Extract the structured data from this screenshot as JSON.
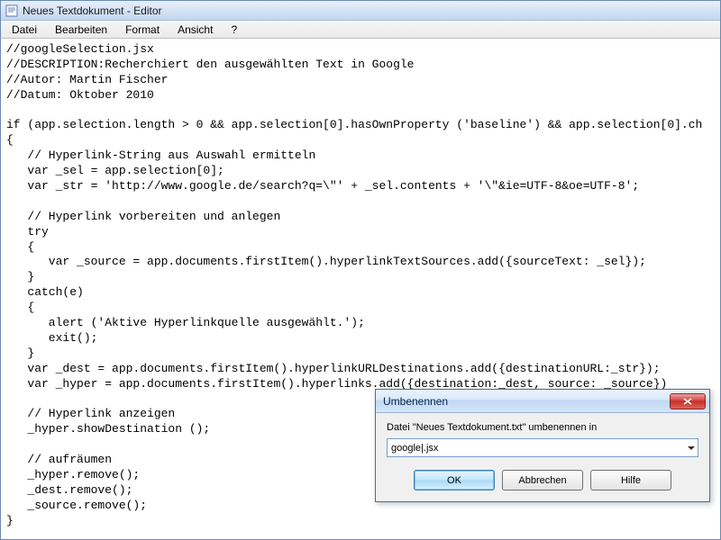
{
  "window": {
    "title": "Neues Textdokument - Editor"
  },
  "menu": {
    "file": "Datei",
    "edit": "Bearbeiten",
    "format": "Format",
    "view": "Ansicht",
    "help": "?"
  },
  "editor": {
    "content": "//googleSelection.jsx\n//DESCRIPTION:Recherchiert den ausgewählten Text in Google\n//Autor: Martin Fischer\n//Datum: Oktober 2010\n\nif (app.selection.length > 0 && app.selection[0].hasOwnProperty ('baseline') && app.selection[0].ch\n{\n   // Hyperlink-String aus Auswahl ermitteln\n   var _sel = app.selection[0];\n   var _str = 'http://www.google.de/search?q=\\\"' + _sel.contents + '\\\"&ie=UTF-8&oe=UTF-8';\n\n   // Hyperlink vorbereiten und anlegen\n   try\n   {\n      var _source = app.documents.firstItem().hyperlinkTextSources.add({sourceText: _sel});\n   }\n   catch(e)\n   {\n      alert ('Aktive Hyperlinkquelle ausgewählt.');\n      exit();\n   }\n   var _dest = app.documents.firstItem().hyperlinkURLDestinations.add({destinationURL:_str});\n   var _hyper = app.documents.firstItem().hyperlinks.add({destination:_dest, source: _source})\n\n   // Hyperlink anzeigen\n   _hyper.showDestination ();\n\n   // aufräumen\n   _hyper.remove();\n   _dest.remove();\n   _source.remove();\n}"
  },
  "dialog": {
    "title": "Umbenennen",
    "label": "Datei \"Neues Textdokument.txt\" umbenennen in",
    "input_value": "google|.jsx",
    "ok": "OK",
    "cancel": "Abbrechen",
    "help": "Hilfe"
  }
}
